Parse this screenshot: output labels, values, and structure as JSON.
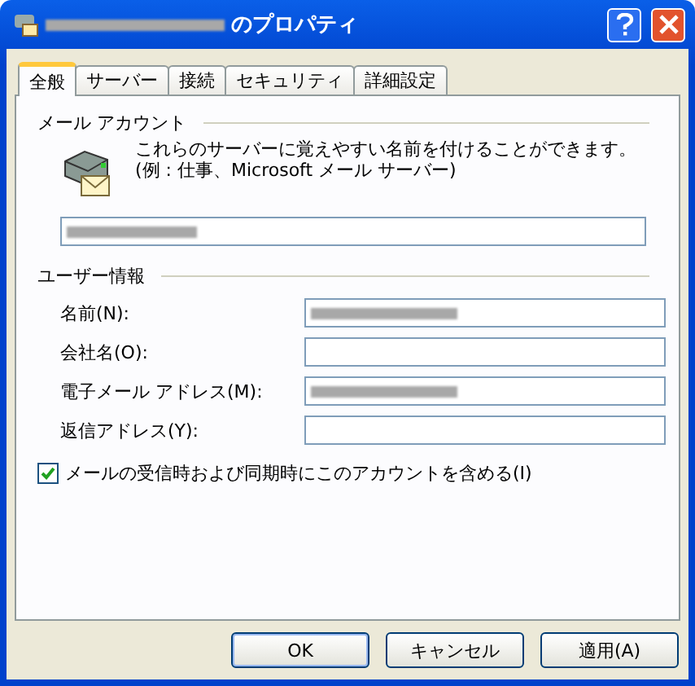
{
  "window": {
    "title": "のプロパティ",
    "title_redacted": true
  },
  "tabs": [
    {
      "label": "全般",
      "selected": true
    },
    {
      "label": "サーバー",
      "selected": false
    },
    {
      "label": "接続",
      "selected": false
    },
    {
      "label": "セキュリティ",
      "selected": false
    },
    {
      "label": "詳細設定",
      "selected": false
    }
  ],
  "mail_account": {
    "heading": "メール アカウント",
    "description": "これらのサーバーに覚えやすい名前を付けることができます。(例 : 仕事、Microsoft メール サーバー)",
    "account_name": {
      "redacted": true
    }
  },
  "user_info": {
    "heading": "ユーザー情報",
    "fields": [
      {
        "label": "名前(N):",
        "redacted": true
      },
      {
        "label": "会社名(O):",
        "redacted": false
      },
      {
        "label": "電子メール アドレス(M):",
        "redacted": true
      },
      {
        "label": "返信アドレス(Y):",
        "redacted": false
      }
    ]
  },
  "include_account": {
    "label": "メールの受信時および同期時にこのアカウントを含める(I)",
    "checked": true
  },
  "buttons": [
    {
      "label": "OK",
      "default": true
    },
    {
      "label": "キャンセル",
      "default": false
    },
    {
      "label": "適用(A)",
      "default": false
    }
  ]
}
